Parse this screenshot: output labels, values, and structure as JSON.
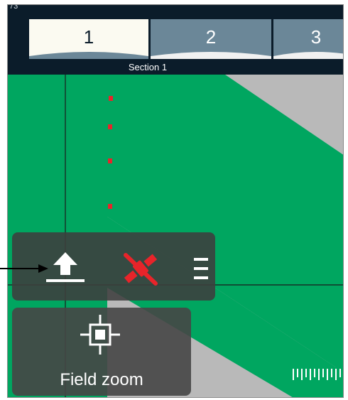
{
  "top_bar": {
    "corner_number": "73",
    "section_label": "Section 1",
    "sections": [
      {
        "label": "1",
        "active": true
      },
      {
        "label": "2",
        "active": false
      },
      {
        "label": "3",
        "active": false
      }
    ]
  },
  "controls": {
    "upload_icon": "upload-icon",
    "gps_icon": "satellite-off-icon",
    "menu_icon": "hamburger-icon",
    "field_zoom_icon": "crosshair-icon",
    "field_zoom_label": "Field zoom"
  },
  "colors": {
    "field_green": "#00a660",
    "unworked_gray": "#b9b9b9",
    "top_bar": "#0b1c2a",
    "active_section": "#fbfaf1",
    "inactive_section": "#6b8798",
    "gps_error_red": "#e8242a",
    "panel": "#3e3e3e"
  }
}
